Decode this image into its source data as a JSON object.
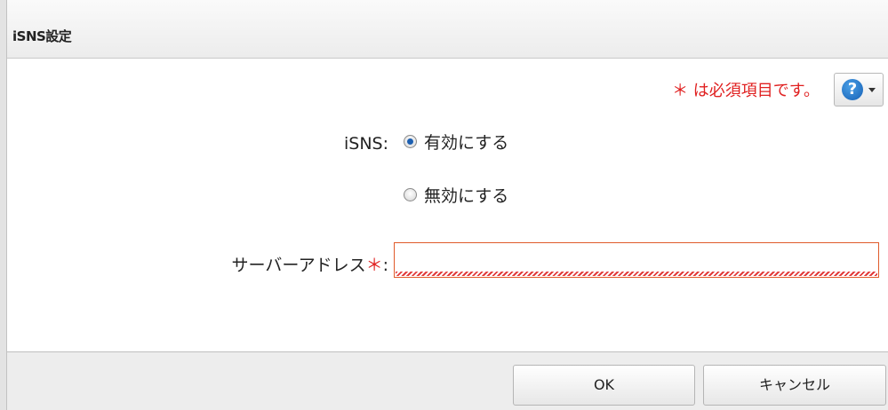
{
  "dialog": {
    "title": "iSNS設定",
    "required_note": "＊ は必須項目です。",
    "help_icon": "question-circle-icon",
    "isns": {
      "label": "iSNS:",
      "options": [
        {
          "label": "有効にする",
          "selected": true
        },
        {
          "label": "無効にする",
          "selected": false
        }
      ]
    },
    "server_address": {
      "label": "サーバーアドレス",
      "required_marker": "＊",
      "colon": ":",
      "value": ""
    },
    "buttons": {
      "ok": "OK",
      "cancel": "キャンセル"
    }
  },
  "colors": {
    "required": "#e02020",
    "input_error_border": "#e05a2a",
    "help_icon": "#1560b5"
  }
}
